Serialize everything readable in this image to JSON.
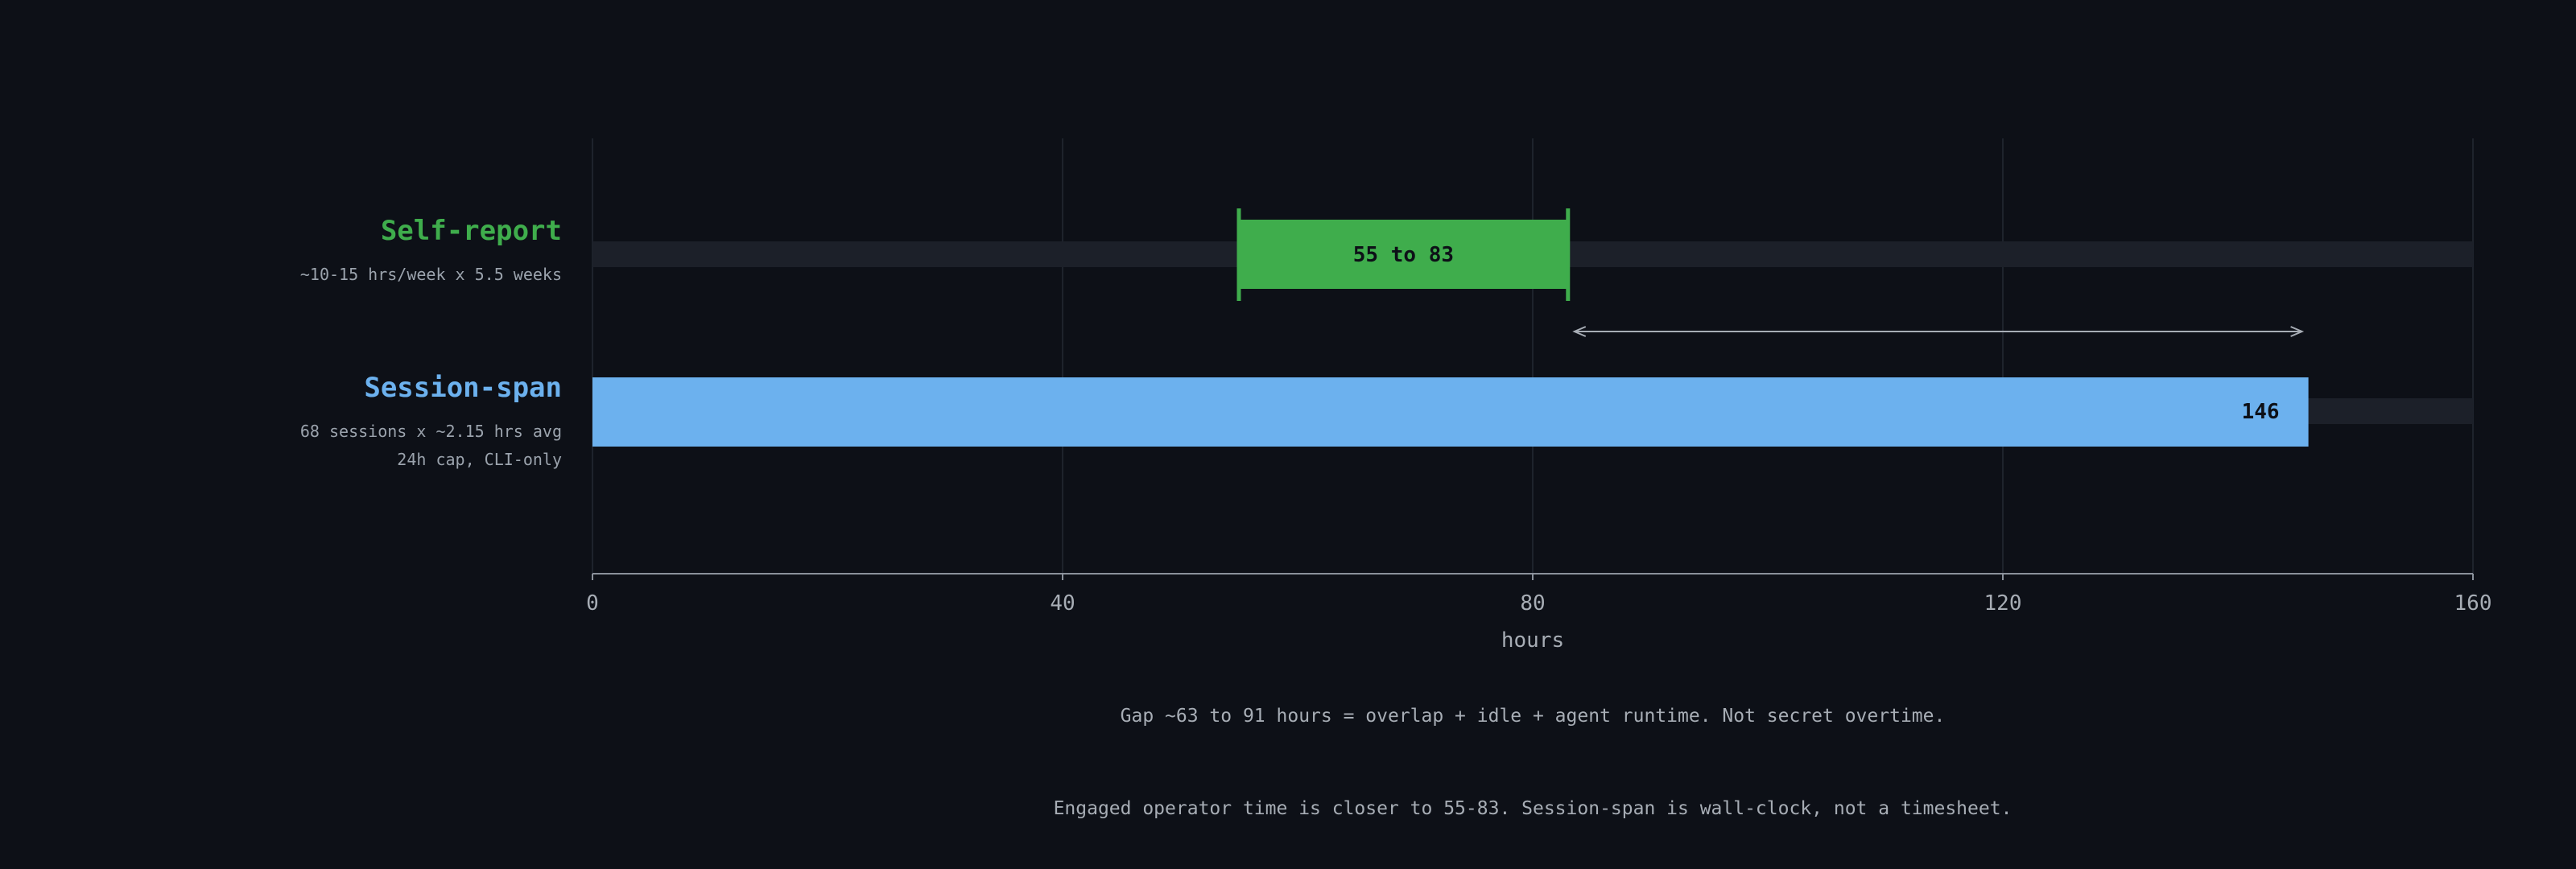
{
  "chart_data": {
    "type": "bar",
    "orientation": "horizontal",
    "xlabel": "hours",
    "xlim": [
      0,
      160
    ],
    "xticks": [
      0,
      40,
      80,
      120,
      160
    ],
    "grid": true,
    "rows": [
      {
        "label": "Self-report",
        "sub": [
          "~10-15 hrs/week x 5.5 weeks"
        ],
        "range": [
          55,
          83
        ],
        "value_label": "55 to 83",
        "color": "#3fad4c"
      },
      {
        "label": "Session-span",
        "sub": [
          "68 sessions x ~2.15 hrs avg",
          "24h cap, CLI-only"
        ],
        "range": [
          0,
          146
        ],
        "value_label": "146",
        "color": "#6cb1ee"
      }
    ],
    "gap_arrow": {
      "from": 83,
      "to": 146
    },
    "notes": [
      "Gap ~63 to 91 hours = overlap + idle + agent runtime. Not secret overtime.",
      "Engaged operator time is closer to 55-83. Session-span is wall-clock, not a timesheet."
    ]
  },
  "colors": {
    "background": "#0d1017",
    "track": "#1c2029",
    "grid": "#1e232c",
    "axis": "#8a919b",
    "self_report": "#3fad4c",
    "session_span": "#6cb1ee",
    "muted_text": "#a7adb5"
  }
}
